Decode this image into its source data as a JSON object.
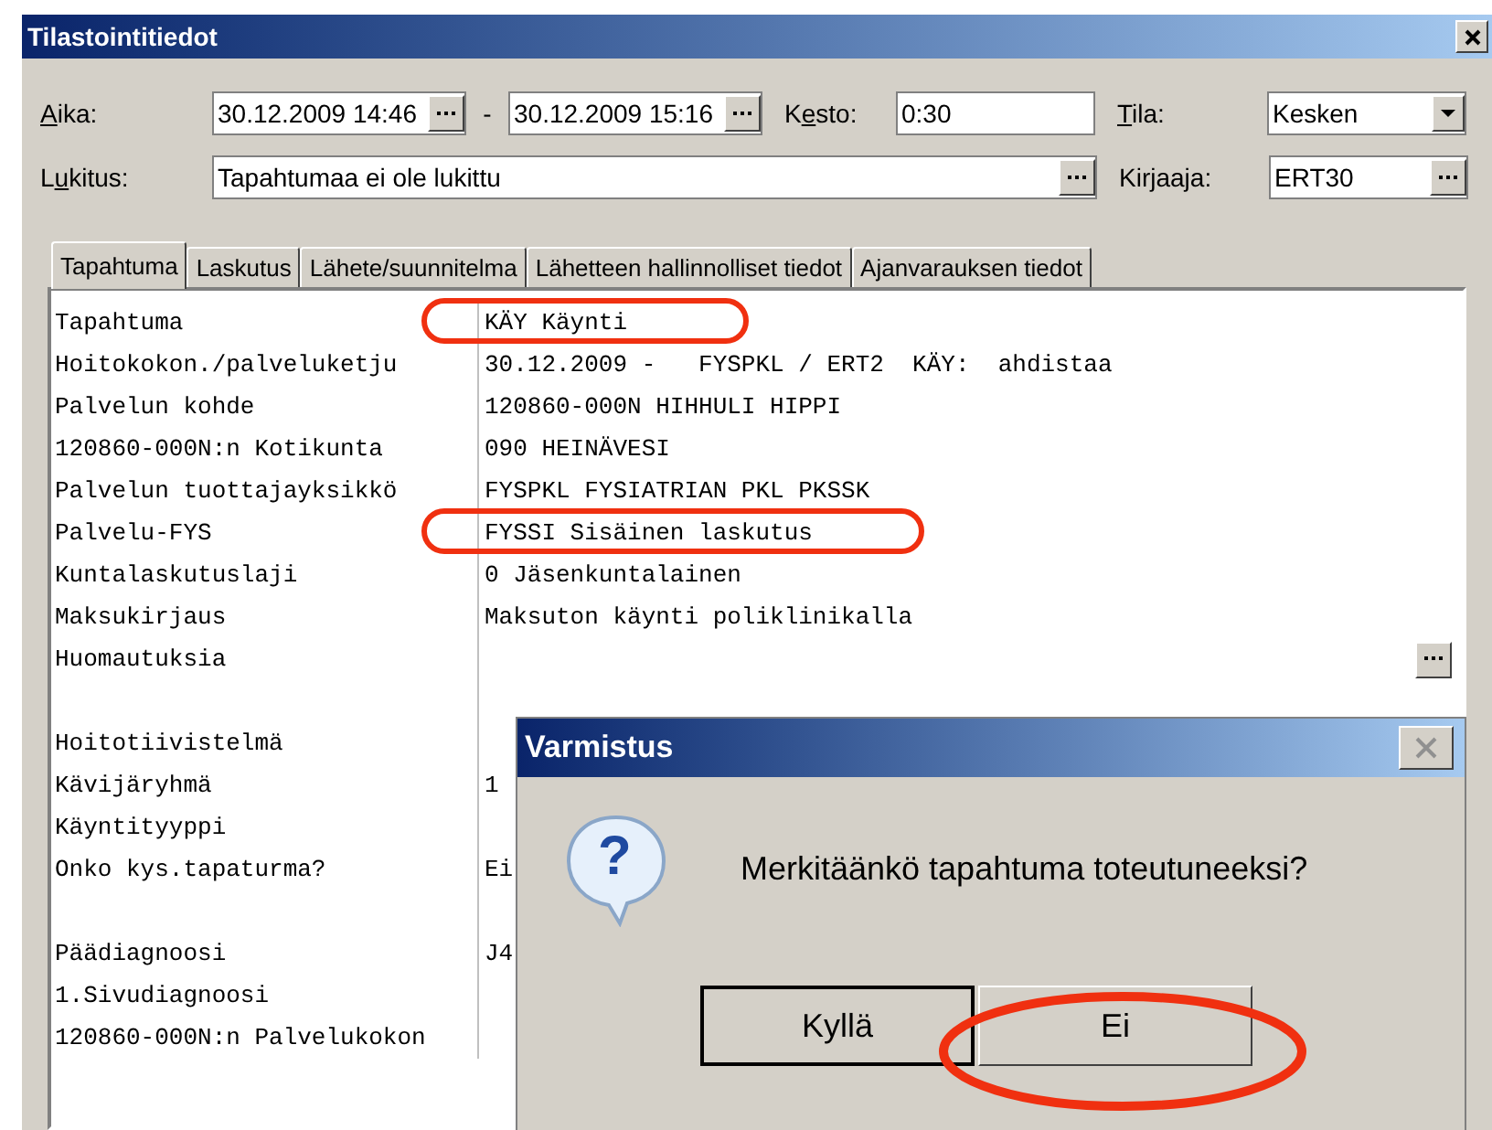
{
  "window": {
    "title": "Tilastointitiedot"
  },
  "form": {
    "time": {
      "label_key": "A",
      "label_after": "ika:",
      "start": "30.12.2009 14:46",
      "separator": "-",
      "end": "30.12.2009 15:16"
    },
    "duration": {
      "label_before": "K",
      "label_key": "e",
      "label_after": "sto:",
      "value": "0:30"
    },
    "state": {
      "label_key": "T",
      "label_after": "ila:",
      "value": "Kesken"
    },
    "lock": {
      "label_before": "L",
      "label_key": "u",
      "label_after": "kitus:",
      "value": "Tapahtumaa ei ole lukittu"
    },
    "recorder": {
      "label_before": "Kirjaaja:",
      "value": "ERT30"
    }
  },
  "tabs": [
    {
      "label": "Tapahtuma",
      "selected": true
    },
    {
      "label": "Laskutus",
      "selected": false
    },
    {
      "label": "Lähete/suunnitelma",
      "selected": false
    },
    {
      "label": "Lähetteen hallinnolliset tiedot",
      "selected": false
    },
    {
      "label": "Ajanvarauksen tiedot",
      "selected": false
    }
  ],
  "rows": [
    {
      "label": "Tapahtuma",
      "value": "KÄY Käynti"
    },
    {
      "label": "Hoitokokon./palveluketju",
      "value": "30.12.2009 -   FYSPKL / ERT2  KÄY:  ahdistaa"
    },
    {
      "label": "Palvelun kohde",
      "value": "120860-000N HIHHULI HIPPI"
    },
    {
      "label": "120860-000N:n Kotikunta",
      "value": "090 HEINÄVESI"
    },
    {
      "label": "Palvelun tuottajayksikkö",
      "value": "FYSPKL FYSIATRIAN PKL PKSSK"
    },
    {
      "label": "Palvelu-FYS",
      "value": "FYSSI Sisäinen laskutus"
    },
    {
      "label": "Kuntalaskutuslaji",
      "value": "0 Jäsenkuntalainen"
    },
    {
      "label": "Maksukirjaus",
      "value": "Maksuton käynti poliklinikalla"
    },
    {
      "label": "Huomautuksia",
      "has_button": true
    },
    {},
    {
      "label": "Hoitotiivistelmä"
    },
    {
      "label": "Kävijäryhmä",
      "value": "1"
    },
    {
      "label": "Käyntityyppi"
    },
    {
      "label": "Onko kys.tapaturma?",
      "value": "Ei"
    },
    {},
    {
      "label": "Päädiagnoosi",
      "value": "J4"
    },
    {
      "label": "1.Sivudiagnoosi"
    },
    {
      "label": "120860-000N:n Palvelukokon"
    }
  ],
  "dialog": {
    "title": "Varmistus",
    "icon_glyph": "?",
    "message": "Merkitäänkö tapahtuma toteutuneeksi?",
    "buttons": [
      {
        "label": "Kyllä",
        "default": true
      },
      {
        "label": "Ei",
        "default": false
      }
    ]
  }
}
